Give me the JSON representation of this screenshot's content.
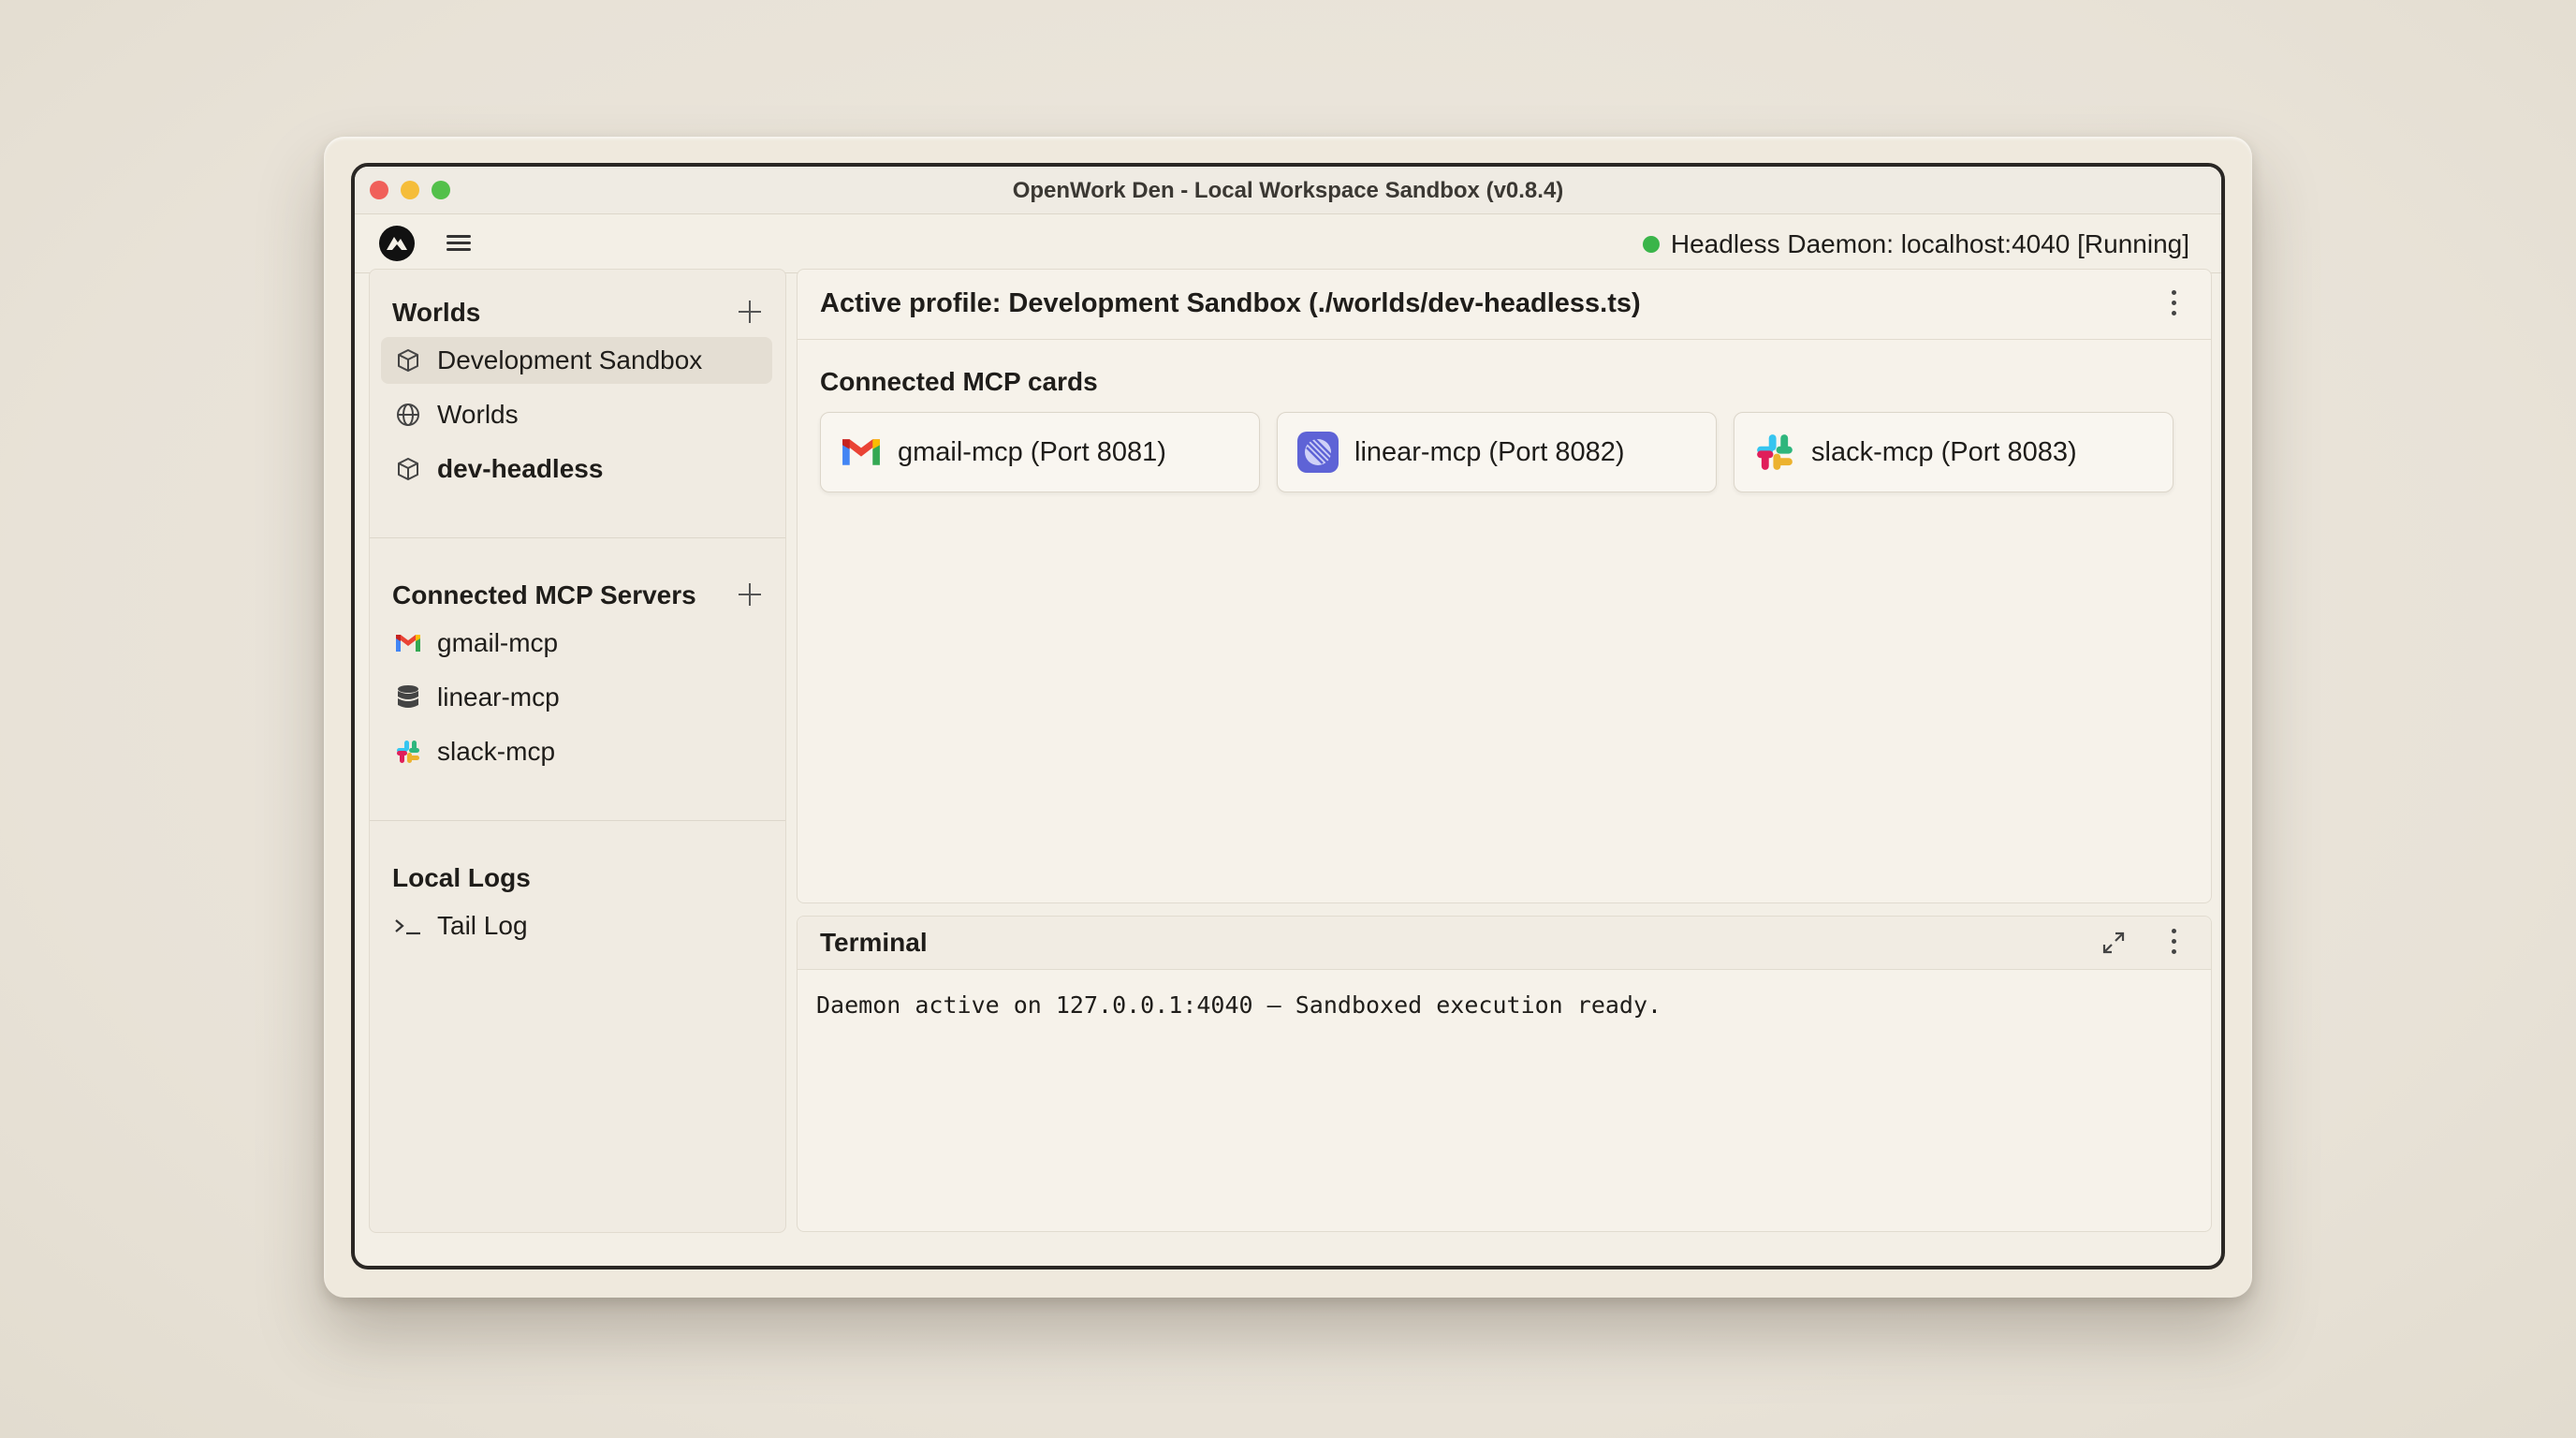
{
  "window": {
    "title": "OpenWork Den - Local Workspace Sandbox (v0.8.4)"
  },
  "toolbar": {
    "status_text": "Headless Daemon: localhost:4040 [Running]",
    "status_color": "#3ab54a"
  },
  "sidebar": {
    "worlds": {
      "heading": "Worlds",
      "items": [
        {
          "label": "Development Sandbox",
          "icon": "cube-icon",
          "active": true
        },
        {
          "label": "Worlds",
          "icon": "globe-icon"
        },
        {
          "label": "dev-headless",
          "icon": "cube-icon",
          "bold": true
        }
      ]
    },
    "servers": {
      "heading": "Connected MCP Servers",
      "items": [
        {
          "label": "gmail-mcp",
          "icon": "gmail-icon"
        },
        {
          "label": "linear-mcp",
          "icon": "database-icon"
        },
        {
          "label": "slack-mcp",
          "icon": "slack-icon"
        }
      ]
    },
    "logs": {
      "heading": "Local Logs",
      "items": [
        {
          "label": "Tail Log",
          "icon": "terminal-prompt-icon"
        }
      ]
    }
  },
  "main": {
    "title": "Active profile: Development Sandbox (./worlds/dev-headless.ts)",
    "cards_heading": "Connected MCP cards",
    "cards": [
      {
        "label": "gmail-mcp (Port 8081)",
        "icon": "gmail-icon"
      },
      {
        "label": "linear-mcp (Port 8082)",
        "icon": "linear-icon"
      },
      {
        "label": "slack-mcp (Port 8083)",
        "icon": "slack-icon"
      }
    ]
  },
  "terminal": {
    "title": "Terminal",
    "output": "Daemon active on 127.0.0.1:4040 – Sandboxed execution ready."
  }
}
